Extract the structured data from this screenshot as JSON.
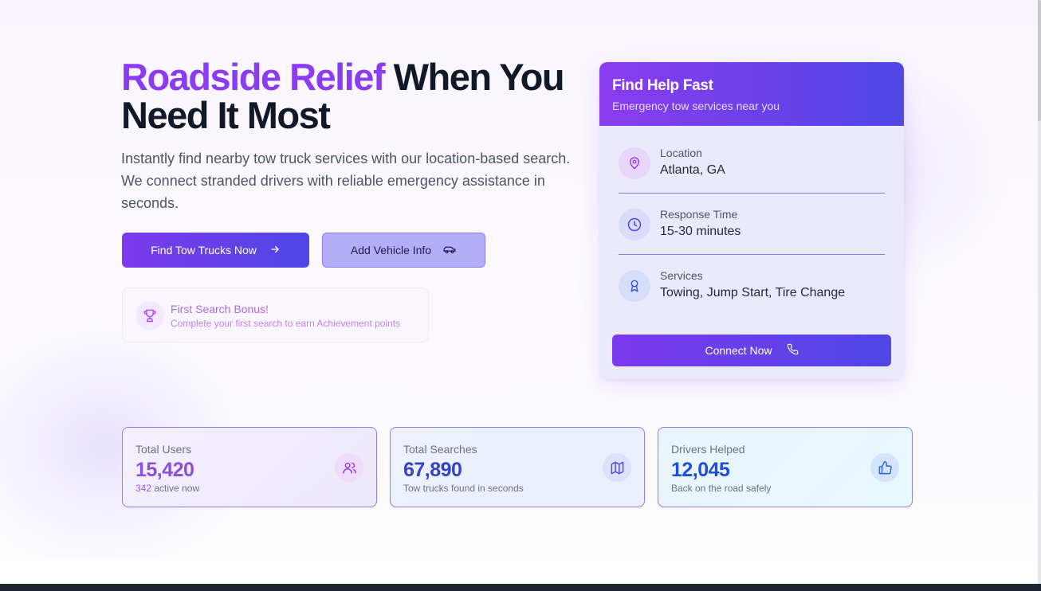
{
  "hero": {
    "title_accent": "Roadside Relief",
    "title_rest_line1": " When You",
    "title_line2": "Need It Most",
    "description": "Instantly find nearby tow truck services with our location-based search. We connect stranded drivers with reliable emergency assistance in seconds.",
    "primary_button": "Find Tow Trucks Now",
    "secondary_button": "Add Vehicle Info"
  },
  "bonus": {
    "icon": "trophy-icon",
    "title": "First Search Bonus!",
    "subtitle": "Complete your first search to earn Achievement points"
  },
  "card": {
    "title": "Find Help Fast",
    "subtitle": "Emergency tow services near you",
    "rows": [
      {
        "icon": "map-pin-icon",
        "label": "Location",
        "value": "Atlanta, GA"
      },
      {
        "icon": "clock-icon",
        "label": "Response Time",
        "value": "15-30 minutes"
      },
      {
        "icon": "award-icon",
        "label": "Services",
        "value": "Towing, Jump Start, Tire Change"
      }
    ],
    "button": "Connect Now"
  },
  "stats": [
    {
      "label": "Total Users",
      "value": "15,420",
      "note_highlight": "342",
      "note": " active now",
      "icon": "users-icon"
    },
    {
      "label": "Total Searches",
      "value": "67,890",
      "note": "Tow trucks found in seconds",
      "icon": "map-icon"
    },
    {
      "label": "Drivers Helped",
      "value": "12,045",
      "note": "Back on the road safely",
      "icon": "thumbs-up-icon"
    }
  ],
  "colors": {
    "accent_purple": "#8b3cf0",
    "accent_indigo": "#4f46e5",
    "stat_blue": "#1d4ed8"
  }
}
